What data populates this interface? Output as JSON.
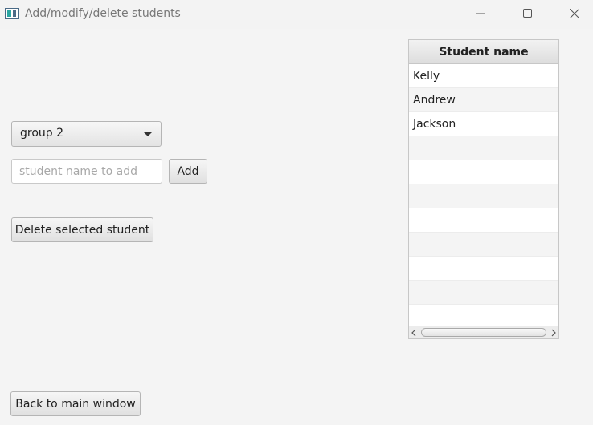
{
  "window": {
    "title": "Add/modify/delete students",
    "icon": "app-icon",
    "controls": [
      "minimize-icon",
      "maximize-icon",
      "close-icon"
    ]
  },
  "group_select": {
    "value": "group 2"
  },
  "add_student": {
    "placeholder": "student name to add",
    "value": "",
    "button_label": "Add"
  },
  "delete_button_label": "Delete selected student",
  "back_button_label": "Back to main window",
  "table": {
    "column_header": "Student name",
    "rows": [
      "Kelly",
      "Andrew",
      "Jackson",
      "",
      "",
      "",
      "",
      "",
      "",
      "",
      ""
    ]
  }
}
